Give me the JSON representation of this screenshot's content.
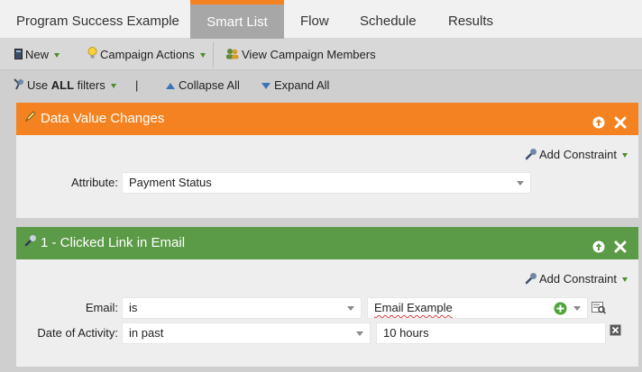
{
  "tabs": [
    {
      "label": "Program Success Example",
      "active": false
    },
    {
      "label": "Smart List",
      "active": true
    },
    {
      "label": "Flow",
      "active": false
    },
    {
      "label": "Schedule",
      "active": false
    },
    {
      "label": "Results",
      "active": false
    }
  ],
  "toolbar": {
    "new_label": "New",
    "campaign_actions_label": "Campaign Actions",
    "view_members_label": "View Campaign Members"
  },
  "filter_options": {
    "use_prefix": "Use",
    "use_bold": "ALL",
    "use_suffix": "filters",
    "separator": "|",
    "collapse_label": "Collapse All",
    "expand_label": "Expand All"
  },
  "filters": [
    {
      "title": "Data Value Changes",
      "color": "#f58220",
      "add_constraint": "Add Constraint",
      "attribute_label": "Attribute:",
      "attribute_value": "Payment Status"
    },
    {
      "title": "1 - Clicked Link in Email",
      "color": "#5b9a46",
      "add_constraint": "Add Constraint",
      "email_label": "Email:",
      "email_operator": "is",
      "email_value": "Email Example",
      "date_label": "Date of Activity:",
      "date_operator": "in past",
      "date_value": "10 hours"
    }
  ],
  "colors": {
    "accent_orange": "#f58220",
    "accent_green": "#5b9a46",
    "link_blue": "#3d74b8"
  }
}
